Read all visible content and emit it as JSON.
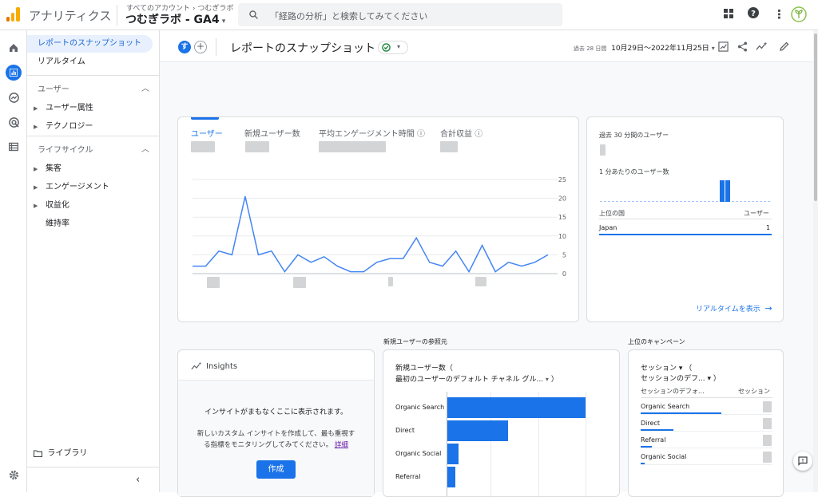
{
  "app": {
    "name": "アナリティクス",
    "breadcrumb": "すべてのアカウント › つむぎラボ",
    "property": "つむぎラボ - GA4"
  },
  "search": {
    "placeholder": "「経路の分析」と検索してみてください"
  },
  "topicons": [
    "apps-icon",
    "help-icon",
    "more-vert-icon",
    "account-avatar-icon"
  ],
  "nav": {
    "items": [
      {
        "label": "レポートのスナップショット",
        "active": true
      },
      {
        "label": "リアルタイム",
        "active": false
      }
    ],
    "section_user": "ユーザー",
    "user_items": [
      "ユーザー属性",
      "テクノロジー"
    ],
    "section_lifecycle": "ライフサイクル",
    "lifecycle_items": [
      "集客",
      "エンゲージメント",
      "収益化"
    ],
    "lifecycle_plain": "維持率",
    "library": "ライブラリ"
  },
  "header": {
    "avatar_letter": "す",
    "title": "レポートのスナップショット",
    "date_prefix": "過去 28 日間",
    "date_range": "10月29日〜2022年11月25日"
  },
  "metrics": {
    "tabs": [
      "ユーザー",
      "新規ユーザー数",
      "平均エンゲージメント時間",
      "合計収益"
    ],
    "y_ticks": [
      "25",
      "20",
      "15",
      "10",
      "5",
      "0"
    ]
  },
  "chart_data": {
    "type": "line",
    "series": [
      {
        "values": [
          2,
          2,
          6,
          5,
          20.5,
          5,
          6,
          0.5,
          5,
          3,
          4.5,
          2,
          0.5,
          0.5,
          3,
          4,
          4,
          9.5,
          3,
          2,
          6,
          0.5,
          7.5,
          0.5,
          3,
          2,
          3,
          5
        ]
      }
    ],
    "ylim": [
      0,
      25
    ],
    "grid": true
  },
  "realtime": {
    "title": "過去 30 分間のユーザー",
    "per_minute": "1 分あたりのユーザー数",
    "col_country": "上位の国",
    "col_users": "ユーザー",
    "country": "Japan",
    "country_value": "1",
    "link": "リアルタイムを表示"
  },
  "sections": {
    "referral_title": "新規ユーザーの参照元",
    "campaign_title": "上位のキャンペーン"
  },
  "insights": {
    "title": "Insights",
    "heading": "インサイトがまもなくここに表示されます。",
    "body1": "新しいカスタム インサイトを作成して、最も重視す",
    "body2": "る指標をモニタリングしてみてください。",
    "link": "詳細",
    "button": "作成"
  },
  "referral": {
    "title1": "新規ユーザー数（",
    "title2": "最初のユーザーのデフォルト チャネル グル...",
    "title2_end": "）",
    "bars": [
      {
        "label": "Organic Search",
        "value": 1.0
      },
      {
        "label": "Direct",
        "value": 0.44
      },
      {
        "label": "Organic Social",
        "value": 0.08
      },
      {
        "label": "Referral",
        "value": 0.06
      }
    ]
  },
  "campaign": {
    "title1": "セッション ▾ （",
    "title2": "セッションのデフ...",
    "title2_end": "▾ ）",
    "col1": "セッションのデフォ...",
    "col2": "セッション",
    "rows": [
      {
        "label": "Organic Search",
        "value": 0.75
      },
      {
        "label": "Direct",
        "value": 0.3
      },
      {
        "label": "Referral",
        "value": 0.1
      },
      {
        "label": "Organic Social",
        "value": 0.04
      }
    ]
  }
}
